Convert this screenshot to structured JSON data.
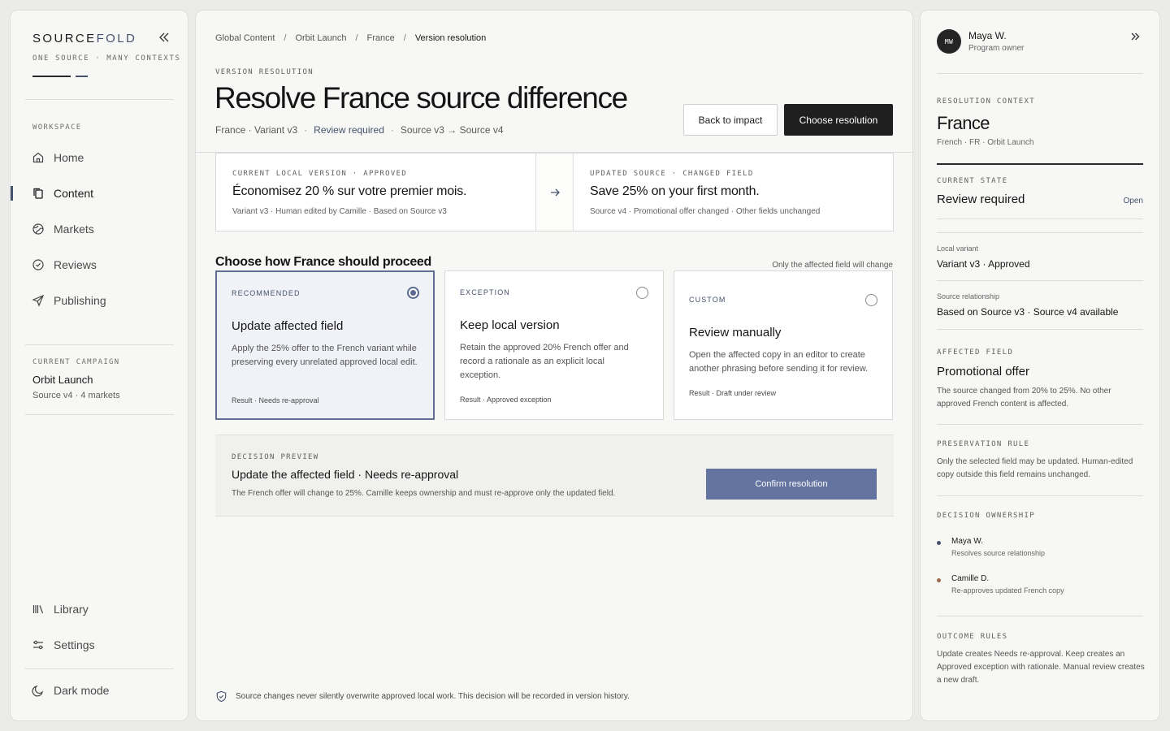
{
  "brand": {
    "name_part1": "SOURCE",
    "name_part2": "FOLD",
    "tagline": "ONE SOURCE · MANY CONTEXTS",
    "accent": "#46526c"
  },
  "sidebar": {
    "section_label": "WORKSPACE",
    "items": [
      {
        "label": "Home",
        "icon": "home-icon"
      },
      {
        "label": "Content",
        "icon": "copy-icon",
        "active": true
      },
      {
        "label": "Markets",
        "icon": "globe-icon"
      },
      {
        "label": "Reviews",
        "icon": "check-circle-icon"
      },
      {
        "label": "Publishing",
        "icon": "send-icon"
      }
    ],
    "campaign": {
      "label": "CURRENT CAMPAIGN",
      "name": "Orbit Launch",
      "meta": "Source v4 · 4 markets"
    },
    "bottom_items": [
      {
        "label": "Library",
        "icon": "library-icon"
      },
      {
        "label": "Settings",
        "icon": "sliders-icon"
      },
      {
        "label": "Dark mode",
        "icon": "moon-icon"
      }
    ]
  },
  "main": {
    "breadcrumb": [
      "Global Content",
      "Orbit Launch",
      "France",
      "Version resolution"
    ],
    "eyebrow": "VERSION RESOLUTION",
    "title": "Resolve France source difference",
    "meta": {
      "variant": "France · Variant v3",
      "status": "Review required",
      "source": "Source v3 → Source v4"
    },
    "buttons": {
      "back": "Back to impact",
      "choose": "Choose resolution"
    },
    "compare": {
      "left": {
        "eyebrow": "CURRENT LOCAL VERSION · APPROVED",
        "text": "Économisez 20 % sur votre premier mois.",
        "meta": "Variant v3 · Human edited by Camille · Based on Source v3"
      },
      "right": {
        "eyebrow": "UPDATED SOURCE · CHANGED FIELD",
        "text": "Save 25% on your first month.",
        "meta": "Source v4 · Promotional offer changed · Other fields unchanged"
      }
    },
    "proceed": {
      "title": "Choose how France should proceed",
      "note": "Only the affected field will change",
      "options": [
        {
          "tag": "RECOMMENDED",
          "title": "Update affected field",
          "desc": "Apply the 25% offer to the French variant while preserving every unrelated approved local edit.",
          "result": "Result · Needs re-approval",
          "selected": true
        },
        {
          "tag": "EXCEPTION",
          "title": "Keep local version",
          "desc": "Retain the approved 20% French offer and record a rationale as an explicit local exception.",
          "result": "Result · Approved exception",
          "selected": false
        },
        {
          "tag": "CUSTOM",
          "title": "Review manually",
          "desc": "Open the affected copy in an editor to create another phrasing before sending it for review.",
          "result": "Result · Draft under review",
          "selected": false
        }
      ]
    },
    "decision": {
      "eyebrow": "DECISION PREVIEW",
      "title": "Update the affected field · Needs re-approval",
      "desc": "The French offer will change to 25%. Camille keeps ownership and must re-approve only the updated field.",
      "confirm": "Confirm resolution"
    },
    "footer_note": "Source changes never silently overwrite approved local work. This decision will be recorded in version history."
  },
  "panel": {
    "user": {
      "initials": "MW",
      "name": "Maya W.",
      "role": "Program owner"
    },
    "context_label": "RESOLUTION CONTEXT",
    "context_title": "France",
    "context_meta": "French · FR · Orbit Launch",
    "state_label": "CURRENT STATE",
    "state_value": "Review required",
    "state_link": "Open",
    "local_variant_label": "Local variant",
    "local_variant_value": "Variant v3 · Approved",
    "source_rel_label": "Source relationship",
    "source_rel_value": "Based on Source v3 · Source v4 available",
    "affected_label": "AFFECTED FIELD",
    "affected_title": "Promotional offer",
    "affected_text": "The source changed from 20% to 25%. No other approved French content is affected.",
    "preservation_label": "PRESERVATION RULE",
    "preservation_text": "Only the selected field may be updated. Human-edited copy outside this field remains unchanged.",
    "ownership_label": "DECISION OWNERSHIP",
    "owners": [
      {
        "name": "Maya W.",
        "role": "Resolves source relationship",
        "color": "#46526c"
      },
      {
        "name": "Camille D.",
        "role": "Re-approves updated French copy",
        "color": "#9a6a4a"
      }
    ],
    "outcome_label": "OUTCOME RULES",
    "outcome_text": "Update creates Needs re-approval. Keep creates an Approved exception with rationale. Manual review creates a new draft."
  }
}
